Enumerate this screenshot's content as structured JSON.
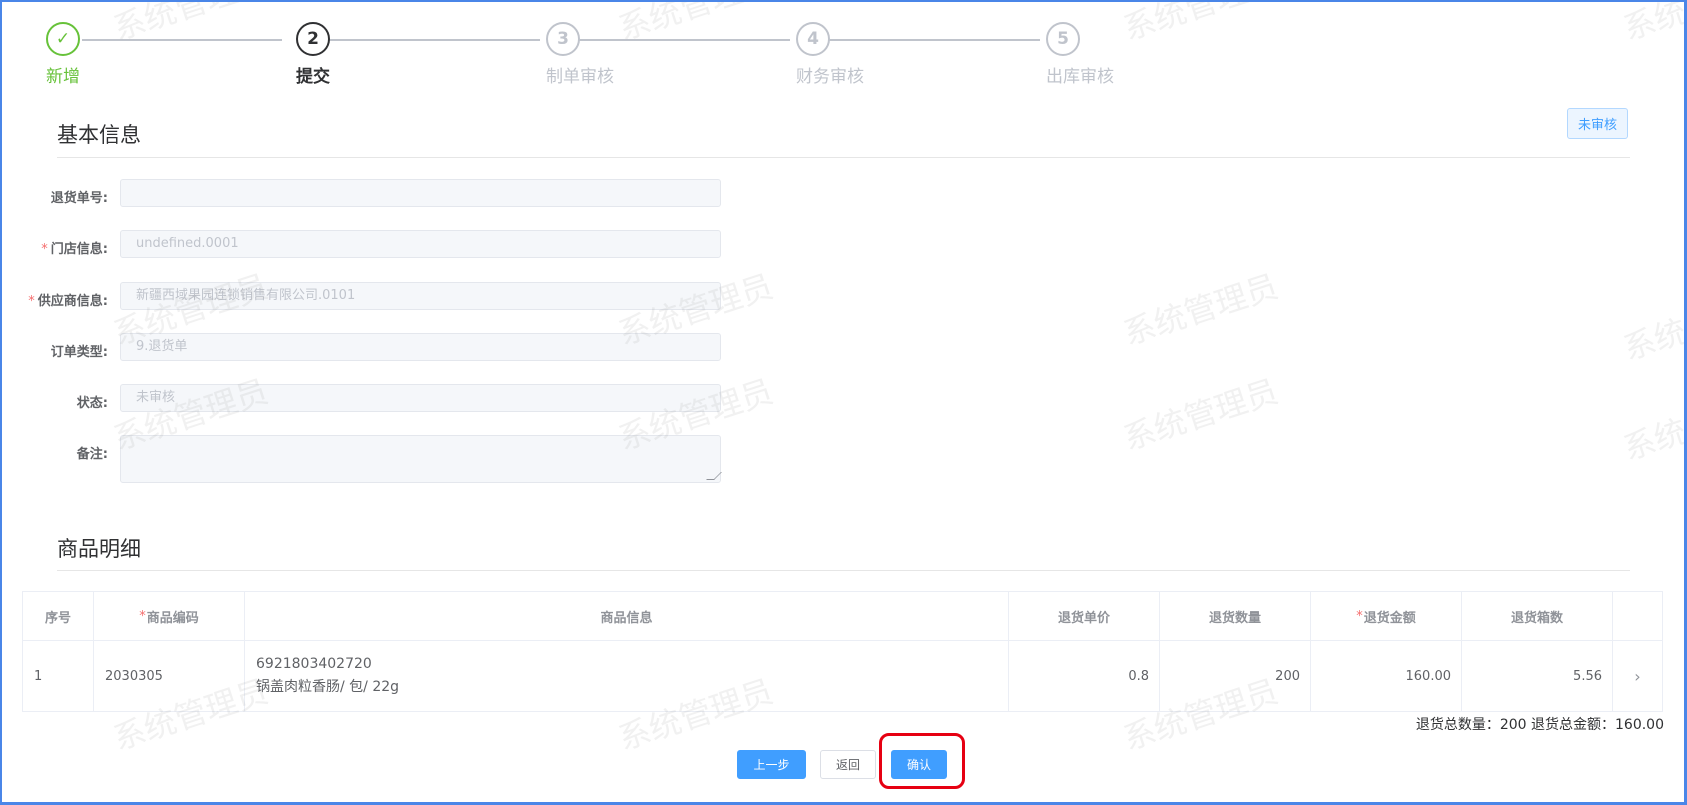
{
  "steps": [
    {
      "number": "✓",
      "label": "新增",
      "state": "done"
    },
    {
      "number": "2",
      "label": "提交",
      "state": "active"
    },
    {
      "number": "3",
      "label": "制单审核",
      "state": "pending"
    },
    {
      "number": "4",
      "label": "财务审核",
      "state": "pending"
    },
    {
      "number": "5",
      "label": "出库审核",
      "state": "pending"
    }
  ],
  "basic_info": {
    "title": "基本信息",
    "status_tag": "未审核",
    "fields": [
      {
        "label": "退货单号:",
        "required": false,
        "value": ""
      },
      {
        "label": "门店信息:",
        "required": true,
        "value": "undefined.0001"
      },
      {
        "label": "供应商信息:",
        "required": true,
        "value": "新疆西域果园连锁销售有限公司.0101"
      },
      {
        "label": "订单类型:",
        "required": false,
        "value": "9.退货单"
      },
      {
        "label": "状态:",
        "required": false,
        "value": "未审核"
      }
    ],
    "remark_label": "备注:",
    "remark_value": ""
  },
  "goods": {
    "title": "商品明细",
    "columns": {
      "index": "序号",
      "code": "商品编码",
      "info": "商品信息",
      "unit_price": "退货单价",
      "quantity": "退货数量",
      "amount": "退货金额",
      "boxes": "退货箱数"
    },
    "rows": [
      {
        "index": "1",
        "code": "2030305",
        "barcode": "6921803402720",
        "name": "锅盖肉粒香肠/ 包/ 22g",
        "unit_price": "0.8",
        "quantity": "200",
        "amount": "160.00",
        "boxes": "5.56"
      }
    ],
    "summary": "退货总数量：200 退货总金额：160.00"
  },
  "buttons": {
    "prev": "上一步",
    "back": "返回",
    "confirm": "确认"
  },
  "watermark_text": "系统管理员",
  "colors": {
    "success": "#67c23a",
    "primary": "#409eff",
    "required": "#f56c6c",
    "highlight": "#e60012"
  }
}
